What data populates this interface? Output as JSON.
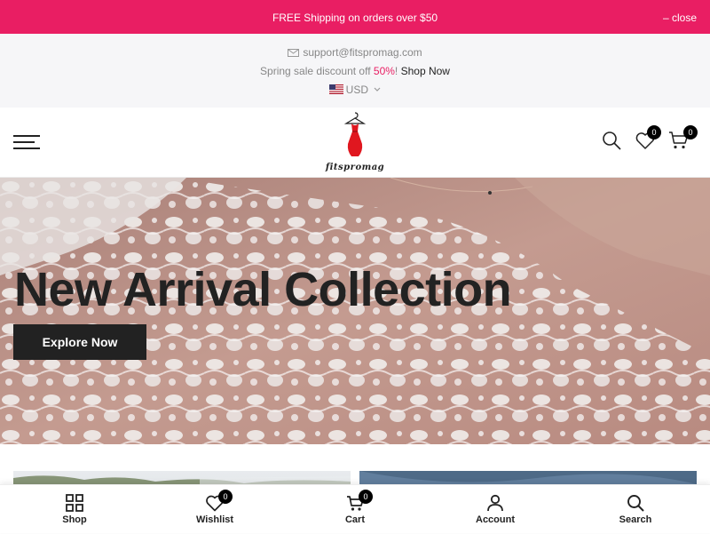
{
  "promo": {
    "text": "FREE Shipping on orders over $50",
    "close_label": "close",
    "color": "#e91e63"
  },
  "topbar": {
    "email": "support@fitspromag.com",
    "sale_text": "Spring sale discount off ",
    "sale_percent": "50%",
    "sale_bang": "! ",
    "shop_link": "Shop Now",
    "currency": "USD",
    "currency_icon": "us-flag-icon"
  },
  "header": {
    "logo_text": "fitspromag",
    "wishlist_count": "0",
    "cart_count": "0",
    "icons": [
      "menu-icon",
      "search-icon",
      "heart-icon",
      "cart-icon"
    ]
  },
  "hero": {
    "title": "New Arrival Collection",
    "button": "Explore Now"
  },
  "bottom_nav": {
    "items": [
      {
        "label": "Shop",
        "icon": "grid-icon"
      },
      {
        "label": "Wishlist",
        "icon": "heart-icon",
        "count": "0"
      },
      {
        "label": "Cart",
        "icon": "cart-icon",
        "count": "0"
      },
      {
        "label": "Account",
        "icon": "user-icon"
      },
      {
        "label": "Search",
        "icon": "search-icon"
      }
    ]
  }
}
